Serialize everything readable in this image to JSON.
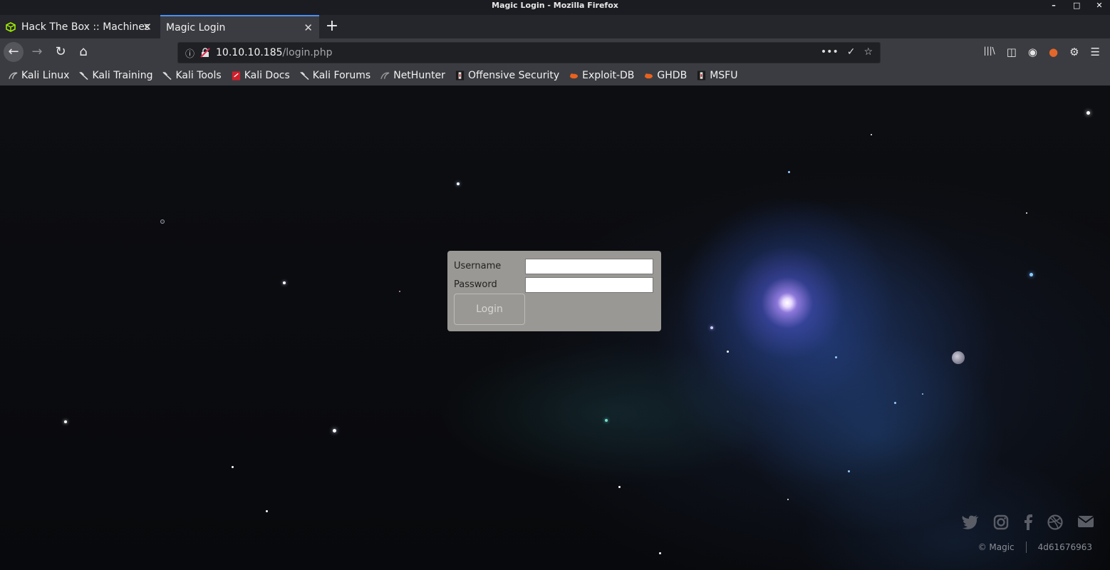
{
  "window": {
    "title": "Magic Login - Mozilla Firefox",
    "controls": [
      "–",
      "□",
      "✕"
    ]
  },
  "tabs": [
    {
      "label": "Hack The Box :: Machines",
      "active": false,
      "favicon": "htb-cube-icon"
    },
    {
      "label": "Magic Login",
      "active": true
    }
  ],
  "tab_close": "✕",
  "new_tab": "+",
  "nav": {
    "back": "←",
    "forward": "→",
    "reload": "↻",
    "home": "⌂"
  },
  "address": {
    "info_icon": "ⓘ",
    "host": "10.10.10.185",
    "path": "/login.php",
    "more": "•••",
    "pocket": "✓",
    "star": "☆"
  },
  "toolbar_right": [
    "|||\\",
    "◫",
    "◉",
    "●",
    "⚙",
    "☰"
  ],
  "bookmarks": [
    {
      "label": "Kali Linux",
      "icon": "kali-dragon-icon"
    },
    {
      "label": "Kali Training",
      "icon": "kali-dragon-icon"
    },
    {
      "label": "Kali Tools",
      "icon": "kali-dragon-icon"
    },
    {
      "label": "Kali Docs",
      "icon": "kali-docs-icon"
    },
    {
      "label": "Kali Forums",
      "icon": "kali-dragon-icon"
    },
    {
      "label": "NetHunter",
      "icon": "nethunter-icon"
    },
    {
      "label": "Offensive Security",
      "icon": "offsec-icon"
    },
    {
      "label": "Exploit-DB",
      "icon": "exploitdb-icon"
    },
    {
      "label": "GHDB",
      "icon": "exploitdb-icon"
    },
    {
      "label": "MSFU",
      "icon": "offsec-icon"
    }
  ],
  "login": {
    "username_label": "Username",
    "password_label": "Password",
    "username_value": "",
    "password_value": "",
    "button_label": "Login"
  },
  "social": [
    "twitter-icon",
    "instagram-icon",
    "facebook-icon",
    "dribbble-icon",
    "mail-icon"
  ],
  "footer": {
    "copyright": "© Magic",
    "hash": "4d61676963"
  },
  "colors": {
    "tab_accent": "#4a8ff5",
    "login_box": "#9a9894",
    "toolbar": "#3b3c41"
  }
}
